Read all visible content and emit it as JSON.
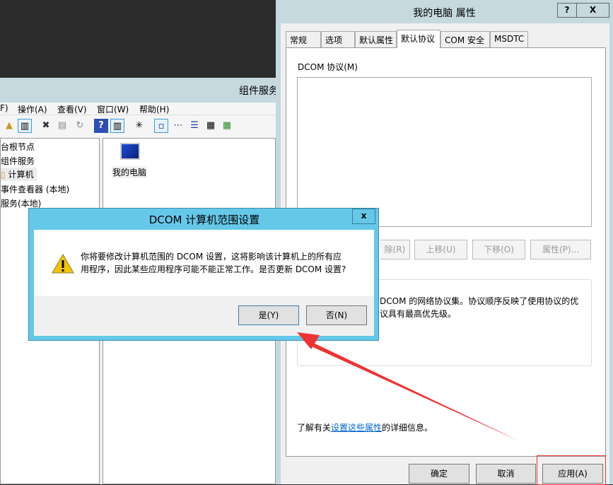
{
  "mmc": {
    "title": "组件服务",
    "menu": [
      "F)",
      "操作(A)",
      "查看(V)",
      "窗口(W)",
      "帮助(H)"
    ],
    "tree": [
      "台根节点",
      "组件服务",
      "计算机",
      "事件查看器 (本地)",
      "服务(本地)"
    ],
    "right_item": "我的电脑"
  },
  "props": {
    "title": "我的电脑 属性",
    "help": "?",
    "close": "X",
    "tabs": [
      "常规",
      "选项",
      "默认属性",
      "默认协议",
      "COM 安全",
      "MSDTC"
    ],
    "active_tab": "默认协议",
    "list_label": "DCOM 协议(M)",
    "buttons": [
      "除(R)",
      "上移(U)",
      "下移(O)",
      "属性(P)..."
    ],
    "desc_line1": "DCOM 的网络协议集。协议顺序反映了使用协议的优",
    "desc_line2": "议具有最高优先级。",
    "info_prefix": "了解有关",
    "info_link": "设置这些属性",
    "info_suffix": "的详细信息。",
    "ok": "确定",
    "cancel": "取消",
    "apply": "应用(A)"
  },
  "dialog": {
    "title": "DCOM 计算机范围设置",
    "close": "x",
    "icon": "warning-icon",
    "line1": "你将要修改计算机范围的 DCOM 设置，这将影响该计算机上的所有应",
    "line2": "用程序，因此某些应用程序可能不能正常工作。是否更新 DCOM 设置?",
    "yes": "是(Y)",
    "no": "否(N)"
  },
  "colors": {
    "annotation": "#ee3333",
    "dialog_frame": "#65c8e8",
    "link": "#0066cc"
  }
}
